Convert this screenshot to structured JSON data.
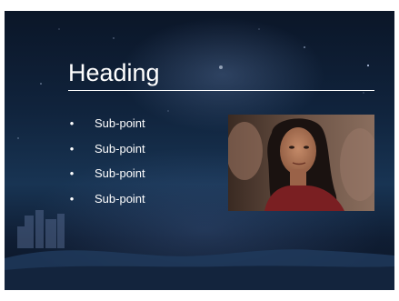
{
  "slide": {
    "heading": "Heading",
    "bullet_glyph": "•",
    "bullets": [
      "Sub-point",
      "Sub-point",
      "Sub-point",
      "Sub-point"
    ]
  },
  "colors": {
    "background": "#10233c",
    "text": "#ffffff"
  }
}
